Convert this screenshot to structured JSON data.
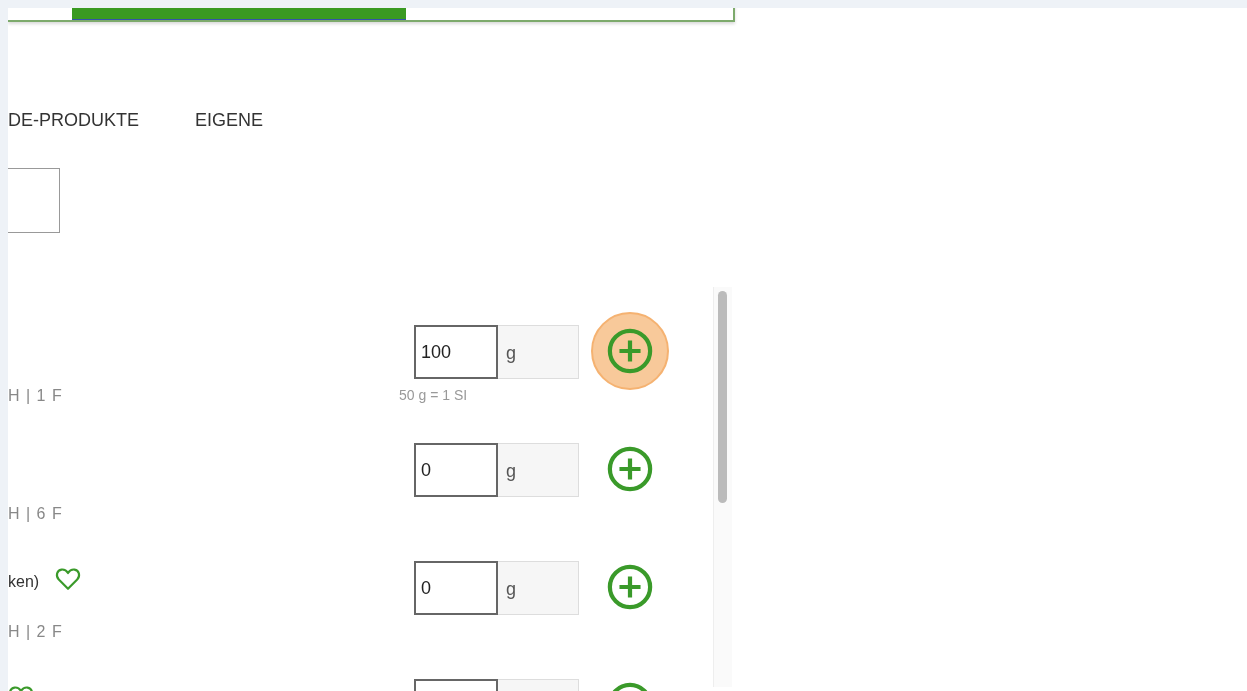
{
  "tabs": [
    {
      "label": "DE-PRODUKTE",
      "selected": false
    },
    {
      "label": "EIGENE",
      "selected": false
    }
  ],
  "foods": [
    {
      "favorite": false,
      "macros": "H | 1 F",
      "amount": "100",
      "unit": "g",
      "hint": "50 g = 1 SI",
      "highlighted": true
    },
    {
      "favorite": false,
      "macros": "H | 6 F",
      "amount": "0",
      "unit": "g",
      "highlighted": false
    },
    {
      "name": "ken)",
      "favorite": true,
      "macros": "H | 2 F",
      "amount": "0",
      "unit": "g",
      "highlighted": false
    },
    {
      "favorite": true,
      "highlighted": false
    }
  ]
}
